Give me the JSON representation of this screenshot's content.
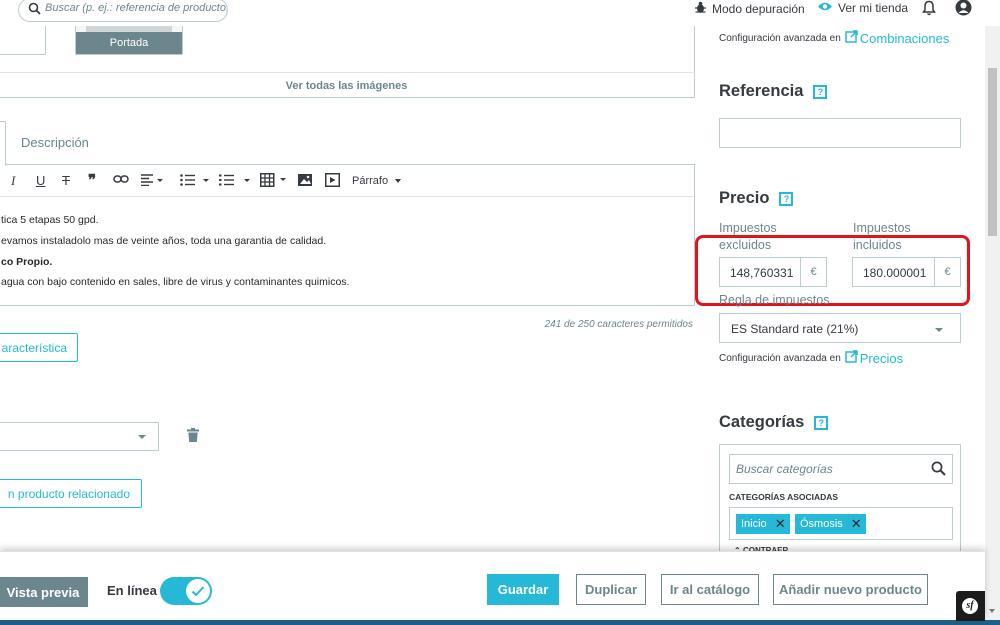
{
  "header": {
    "search_placeholder": "Buscar (p. ej.: referencia de producto, no",
    "debug_mode": "Modo depuración",
    "view_store": "Ver mi tienda"
  },
  "images": {
    "cover_caption": "Portada",
    "view_all": "Ver todas las imágenes"
  },
  "tabs": {
    "description": "Descripción"
  },
  "editor": {
    "paragraph_format": "Párrafo",
    "lines": [
      "tica 5 etapas 50 gpd.",
      "evamos instaladolo mas de veinte años, toda una garantia de calidad.",
      "co Propio.",
      "agua con bajo contenido en sales, libre de virus y contaminantes quimicos."
    ],
    "char_count": "241 de 250 caracteres permitidos"
  },
  "features": {
    "add_feature_button": "aracterística",
    "add_related_button": "n producto relacionado"
  },
  "sidebar": {
    "advanced_config_label": "Configuración avanzada en",
    "combinations_link": "Combinaciones",
    "reference_title": "Referencia",
    "reference_value": "",
    "price_title": "Precio",
    "tax_excl_label": "Impuestos excluidos",
    "tax_incl_label": "Impuestos incluidos",
    "price_tax_excl": "148,760331",
    "price_tax_incl": "180.000001",
    "currency": "€",
    "tax_rule_label": "Regla de impuestos",
    "tax_rule_value": "ES Standard rate (21%)",
    "prices_link": "Precios",
    "categories_title": "Categorías",
    "category_search_placeholder": "Buscar categorías",
    "associated_categories_label": "CATEGORÍAS ASOCIADAS",
    "category_tags": [
      "Inicio",
      "Ósmosis"
    ],
    "collapse_label": "CONTRAER"
  },
  "footer": {
    "preview": "Vista previa",
    "online": "En línea",
    "save": "Guardar",
    "duplicate": "Duplicar",
    "go_to_catalog": "Ir al catálogo",
    "add_new_product": "Añadir nuevo producto"
  },
  "symfony_badge": "sf",
  "colors": {
    "accent": "#25b9d7",
    "highlight_box": "#e0141b",
    "muted": "#6c868e",
    "border": "#bbcdd2"
  }
}
